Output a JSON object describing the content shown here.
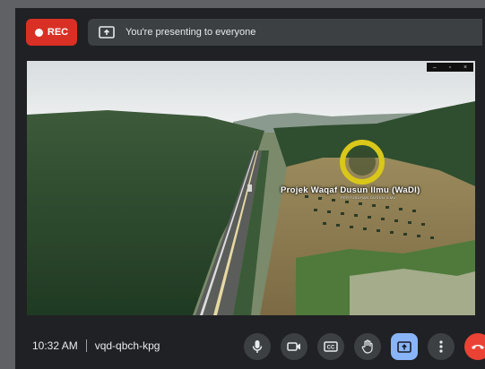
{
  "recording": {
    "label": "REC"
  },
  "banner": {
    "text": "You're presenting to everyone"
  },
  "video": {
    "overlay_title": "Projek Waqaf Dusun Ilmu (WaDI)",
    "overlay_subtitle": "PERTUBUHAN DUSUN ILMU"
  },
  "meeting": {
    "time": "10:32 AM",
    "code": "vqd-qbch-kpg"
  },
  "controls": [
    {
      "name": "microphone",
      "icon": "mic-icon"
    },
    {
      "name": "camera",
      "icon": "camera-icon"
    },
    {
      "name": "captions",
      "icon": "captions-icon",
      "label": "CC"
    },
    {
      "name": "raise-hand",
      "icon": "hand-icon"
    },
    {
      "name": "present",
      "icon": "present-icon",
      "state": "active"
    },
    {
      "name": "more-options",
      "icon": "more-vert-icon"
    },
    {
      "name": "leave-call",
      "icon": "phone-hangup-icon"
    }
  ],
  "colors": {
    "rec": "#d93025",
    "active_control": "#8ab4f8",
    "leave": "#ea4335",
    "bar": "#202124"
  }
}
